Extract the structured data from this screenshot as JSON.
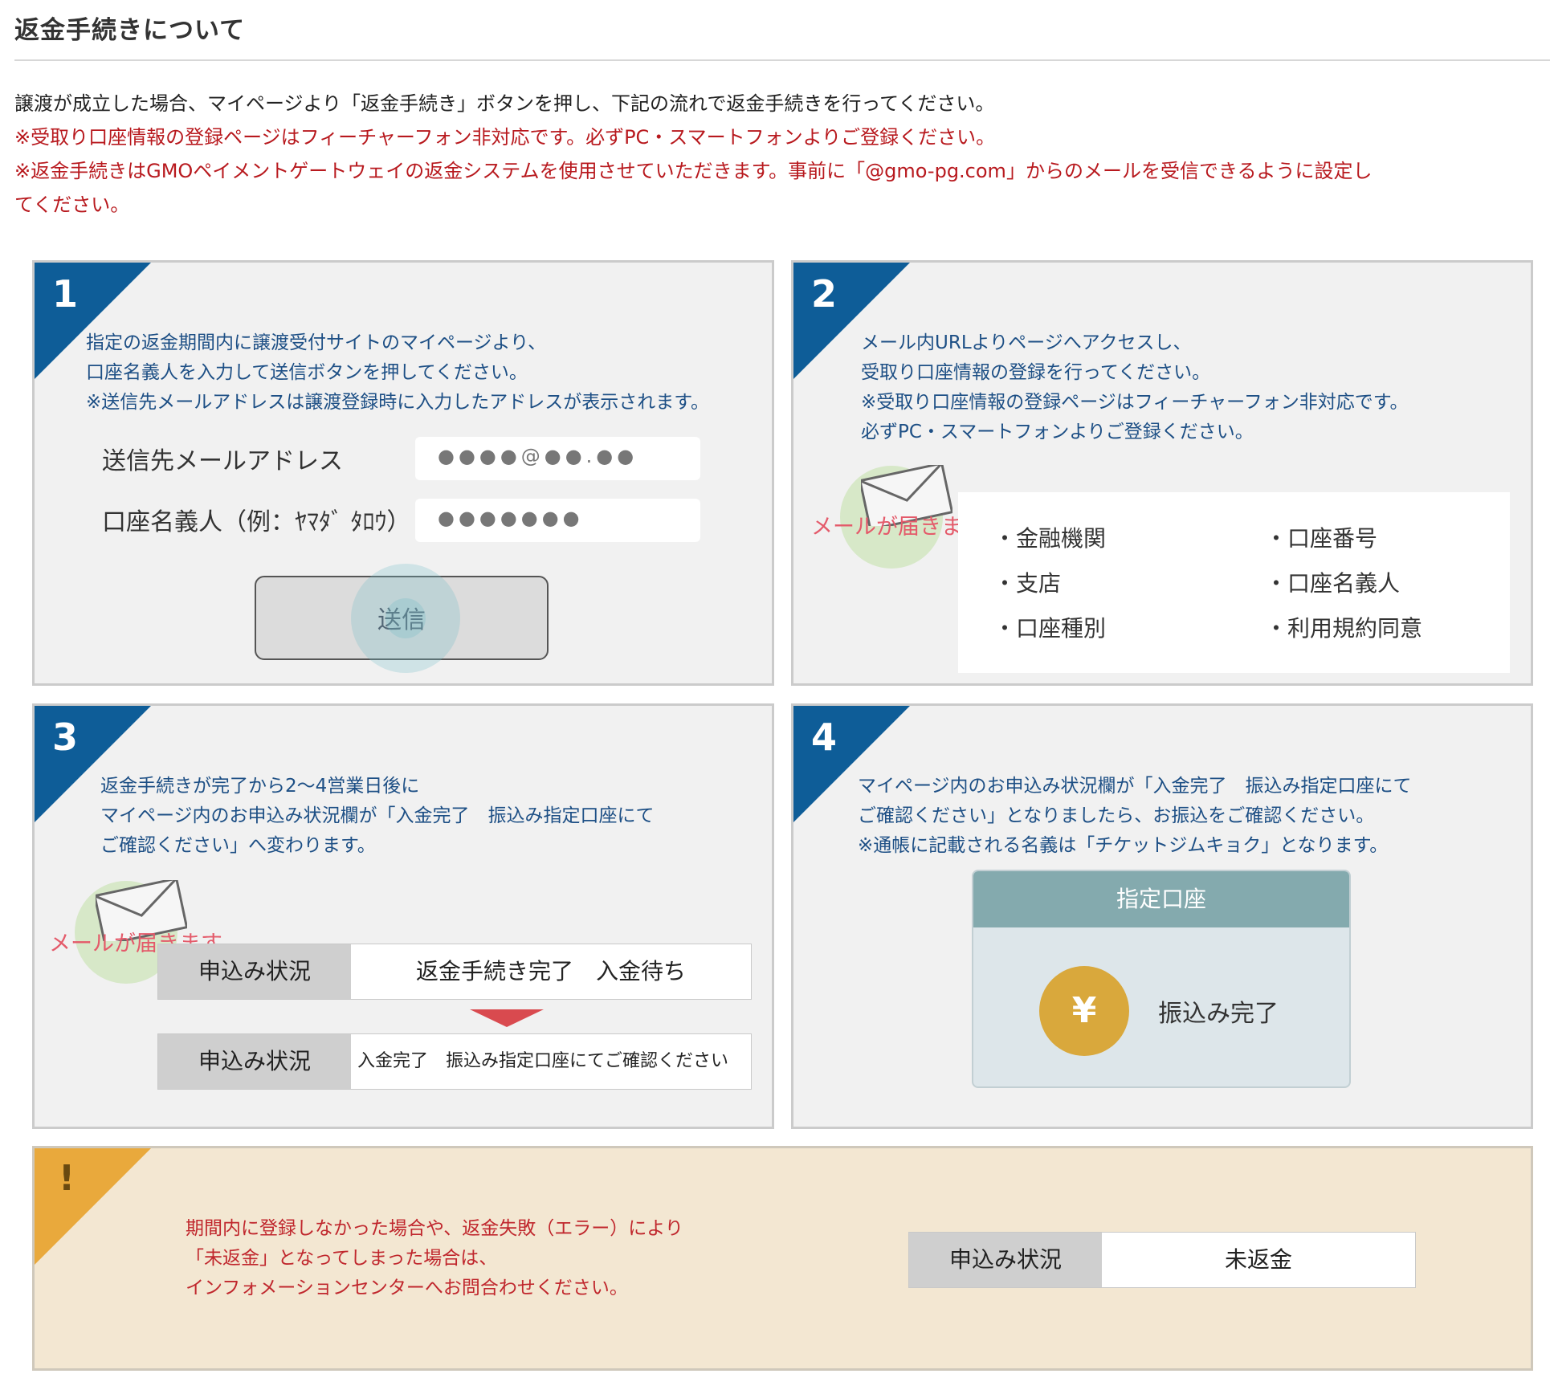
{
  "page": {
    "title": "返金手続きについて",
    "intro": [
      "譲渡が成立した場合、マイページより「返金手続き」ボタンを押し、下記の流れで返金手続きを行ってください。"
    ],
    "notes": [
      "※受取り口座情報の登録ページはフィーチャーフォン非対応です。必ずPC・スマートフォンよりご登録ください。",
      "※返金手続きはGMOペイメントゲートウェイの返金システムを使用させていただきます。事前に「@gmo-pg.com」からのメールを受信できるように設定し",
      "てください。"
    ]
  },
  "step1": {
    "number": "1",
    "lines": [
      "指定の返金期間内に譲渡受付サイトのマイページより、",
      "口座名義人を入力して送信ボタンを押してください。",
      "※送信先メールアドレスは譲渡登録時に入力したアドレスが表示されます。"
    ],
    "email_label": "送信先メールアドレス",
    "email_value": "●●●●@●●.●●",
    "name_label": "口座名義人（例：ﾔﾏﾀﾞ ﾀﾛｳ）",
    "name_value": "●●●●●●●",
    "send_label": "送信"
  },
  "step2": {
    "number": "2",
    "lines": [
      "メール内URLよりページへアクセスし、",
      "受取り口座情報の登録を行ってください。",
      "※受取り口座情報の登録ページはフィーチャーフォン非対応です。",
      "必ずPC・スマートフォンよりご登録ください。"
    ],
    "mail_caption": "メールが届きます",
    "items": [
      "・金融機関",
      "・口座番号",
      "・支店",
      "・口座名義人",
      "・口座種別",
      "・利用規約同意"
    ]
  },
  "step3": {
    "number": "3",
    "lines": [
      "返金手続きが完了から2～4営業日後に",
      "マイページ内のお申込み状況欄が「入金完了　振込み指定口座にて",
      "ご確認ください」へ変わります。"
    ],
    "mail_caption": "メールが届きます",
    "status_label": "申込み状況",
    "status_before": "返金手続き完了　入金待ち",
    "status_after": "入金完了　振込み指定口座にてご確認ください"
  },
  "step4": {
    "number": "4",
    "lines": [
      "マイページ内のお申込み状況欄が「入金完了　振込み指定口座にて",
      "ご確認ください」となりましたら、お振込をご確認ください。",
      "※通帳に記載される名義は「チケットジムキョク」となります。"
    ],
    "account_title": "指定口座",
    "yen": "¥",
    "account_status": "振込み完了"
  },
  "warning": {
    "mark": "!",
    "lines": [
      "期間内に登録しなかった場合や、返金失敗（エラー）により",
      "「未返金」となってしまった場合は、",
      "インフォメーションセンターへお問合わせください。"
    ],
    "status_label": "申込み状況",
    "status_value": "未返金"
  },
  "colors": {
    "step_corner": "#0e5d98",
    "warning_corner": "#e9a93c",
    "note_red": "#b8191e",
    "step_text_blue": "#1d4f85",
    "account_header": "#84aaae",
    "yen_coin": "#d9a83c",
    "mail_caption": "#e45a6a"
  },
  "icons": [
    "envelope-icon",
    "yen-coin-icon",
    "down-arrow-icon",
    "warning-icon"
  ]
}
